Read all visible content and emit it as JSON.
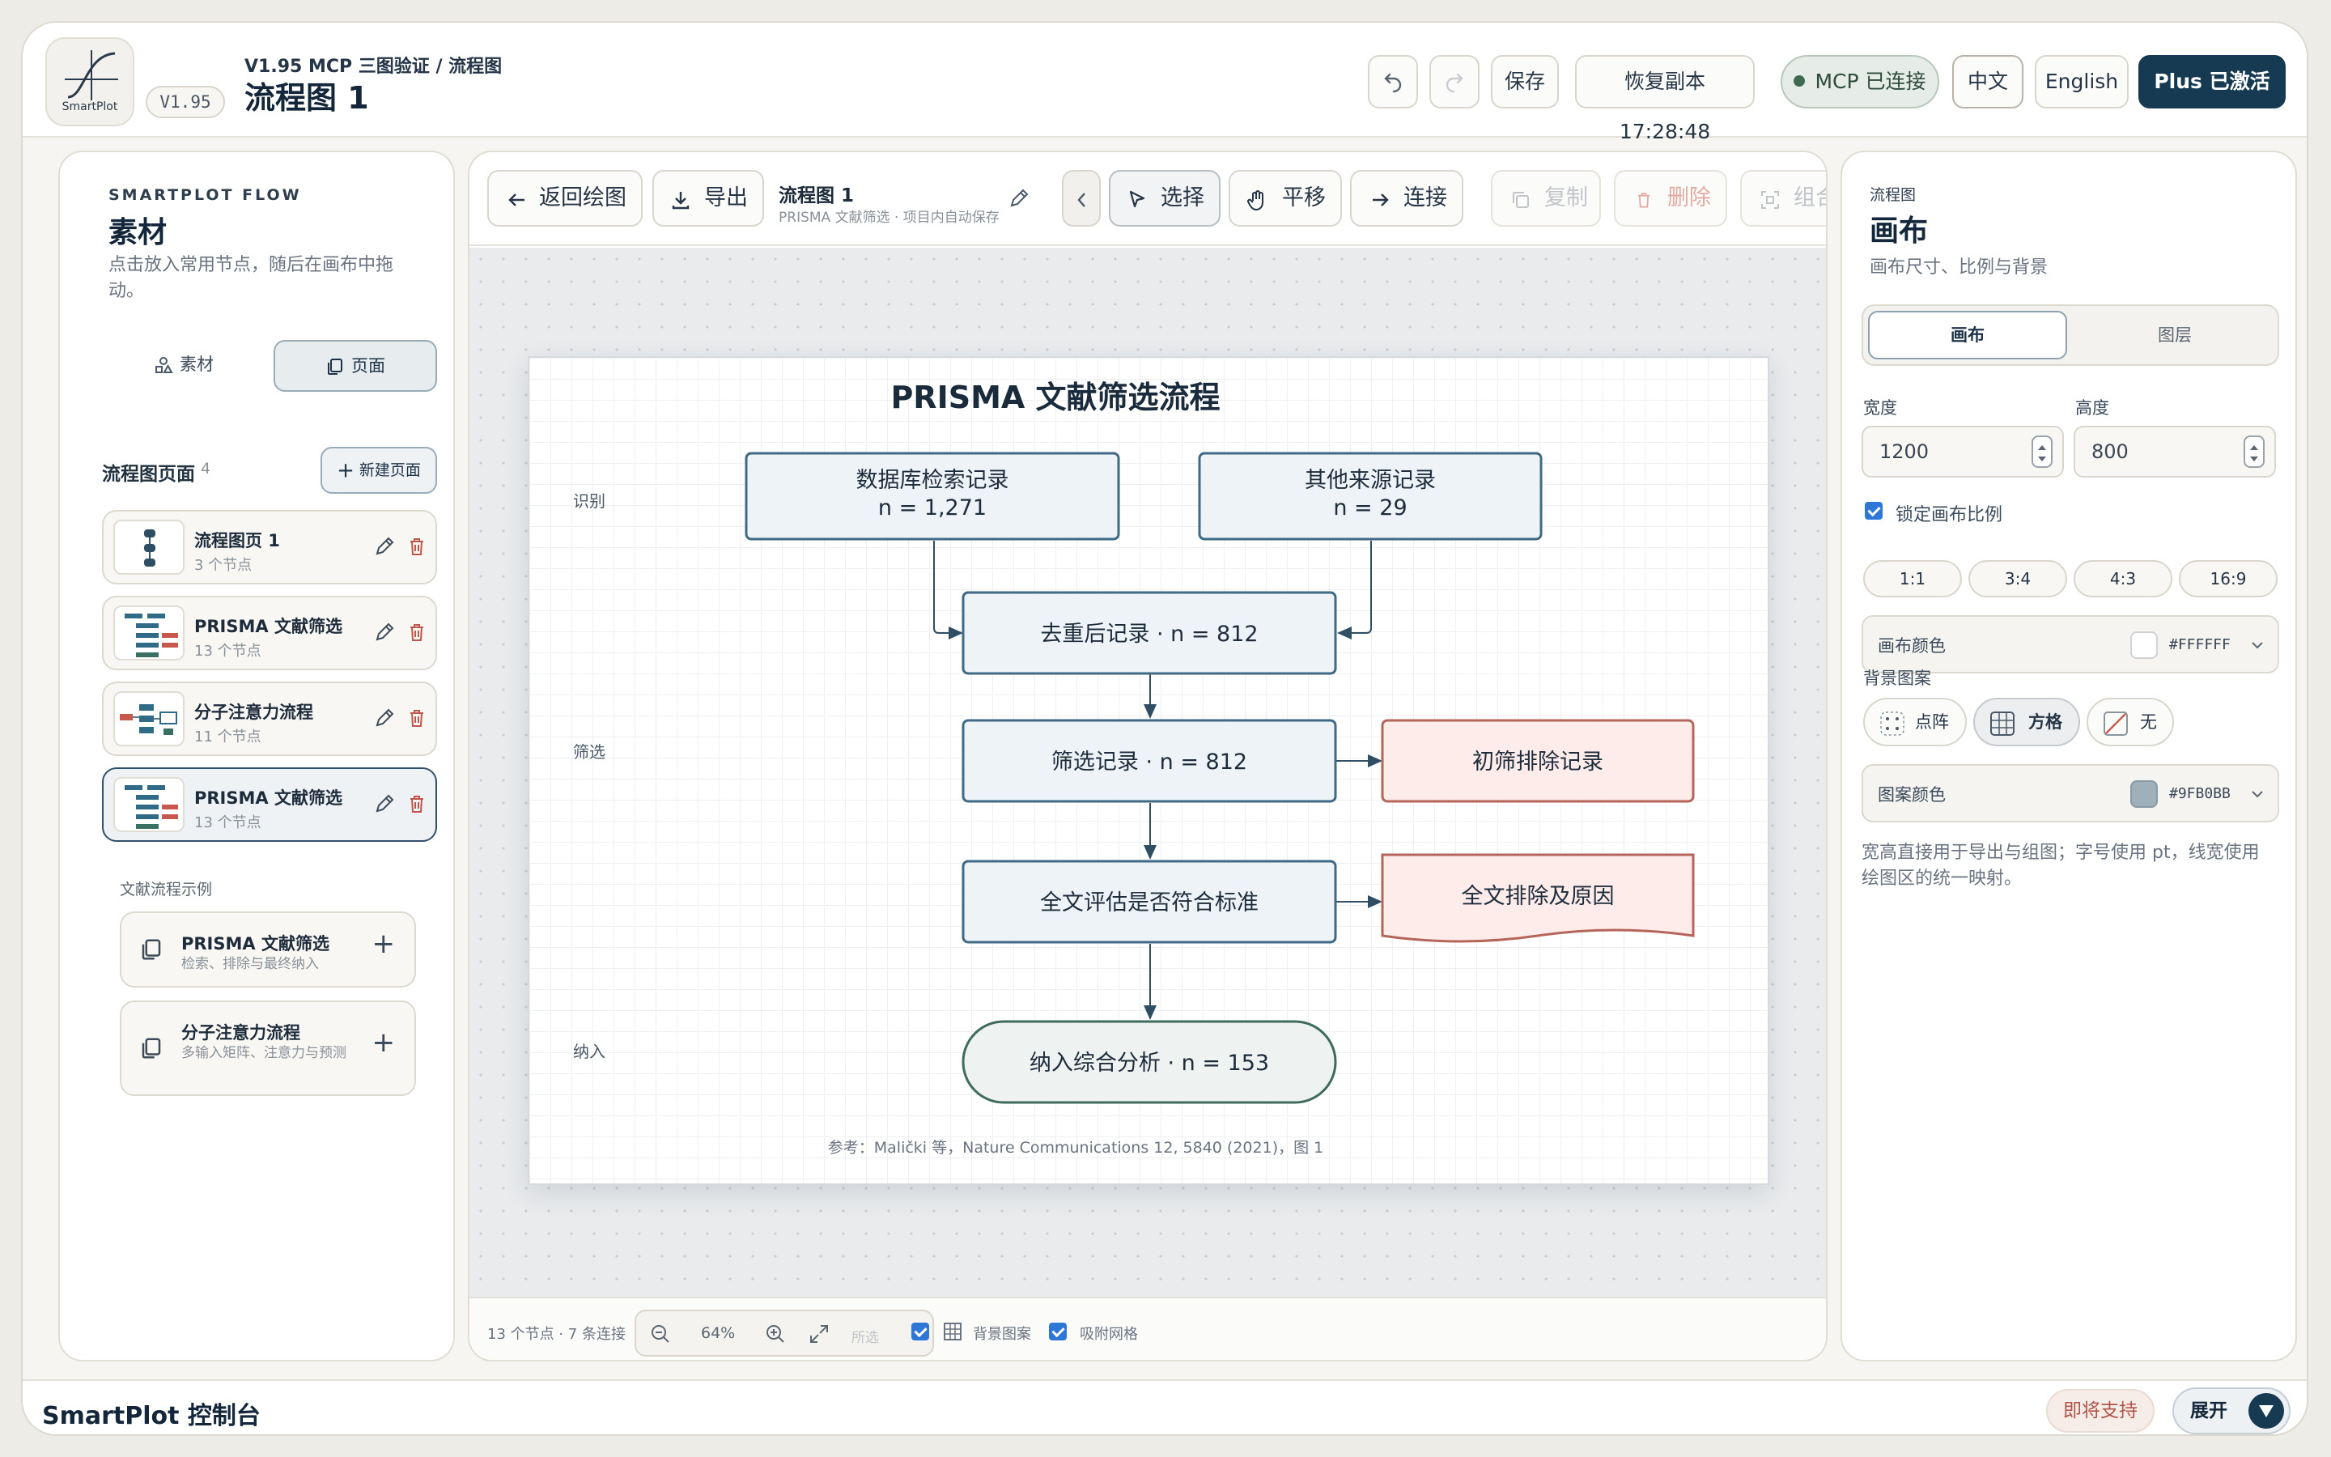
{
  "app": {
    "logo_text": "SmartPlot",
    "version_badge": "V1.95",
    "breadcrumb": "V1.95 MCP 三图验证 / 流程图",
    "title": "流程图 1"
  },
  "header_actions": {
    "save": "保存",
    "restore": "恢复副本 17:28:48",
    "mcp_status": "MCP 已连接",
    "lang_zh": "中文",
    "lang_en": "English",
    "plus": "Plus 已激活"
  },
  "left_panel": {
    "eyebrow": "SMARTPLOT FLOW",
    "title": "素材",
    "description": "点击放入常用节点，随后在画布中拖动。",
    "tabs": [
      {
        "label": "素材",
        "icon": "shapes-icon"
      },
      {
        "label": "页面",
        "icon": "pages-icon",
        "active": true
      }
    ],
    "pages_section": "流程图页面",
    "pages_count": "4",
    "new_page": "新建页面",
    "pages": [
      {
        "name": "流程图页 1",
        "meta": "3 个节点"
      },
      {
        "name": "PRISMA 文献筛选",
        "meta": "13 个节点"
      },
      {
        "name": "分子注意力流程",
        "meta": "11 个节点"
      },
      {
        "name": "PRISMA 文献筛选",
        "meta": "13 个节点",
        "active": true
      }
    ],
    "examples_label": "文献流程示例",
    "examples": [
      {
        "name": "PRISMA 文献筛选",
        "desc": "检索、排除与最终纳入"
      },
      {
        "name": "分子注意力流程",
        "desc": "多输入矩阵、注意力与预测"
      }
    ]
  },
  "toolbar": {
    "back": "返回绘图",
    "export": "导出",
    "doc_title": "流程图 1",
    "doc_sub": "PRISMA 文献筛选 · 项目内自动保存",
    "select": "选择",
    "pan": "平移",
    "connect": "连接",
    "copy": "复制",
    "delete": "删除",
    "group": "组合"
  },
  "diagram": {
    "title": "PRISMA 文献筛选流程",
    "stages": [
      "识别",
      "筛选",
      "纳入"
    ],
    "nodes": {
      "db_title": "数据库检索记录",
      "db_n": "n = 1,271",
      "other_title": "其他来源记录",
      "other_n": "n = 29",
      "dedup": "去重后记录 · n = 812",
      "screen": "筛选记录 · n = 812",
      "excl1": "初筛排除记录",
      "fulltext": "全文评估是否符合标准",
      "excl2": "全文排除及原因",
      "include": "纳入综合分析 · n = 153"
    },
    "reference": "参考：Maličk i 等，Nature Communications 12, 5840 (2021)，图 1"
  },
  "statusbar": {
    "summary": "13 个节点 · 7 条连接",
    "zoom": "64%",
    "fit": "所选",
    "bg_pattern": "背景图案",
    "snap_grid": "吸附网格"
  },
  "right_panel": {
    "eyebrow": "流程图",
    "title": "画布",
    "description": "画布尺寸、比例与背景",
    "seg_canvas": "画布",
    "seg_layers": "图层",
    "width_label": "宽度",
    "height_label": "高度",
    "width_value": "1200",
    "height_value": "800",
    "lock_ratio": "锁定画布比例",
    "ratios": [
      "1:1",
      "3:4",
      "4:3",
      "16:9"
    ],
    "canvas_color_label": "画布颜色",
    "canvas_color": "#FFFFFF",
    "pattern_label": "背景图案",
    "patterns": [
      "点阵",
      "方格",
      "无"
    ],
    "pattern_color_label": "图案颜色",
    "pattern_color": "#9FB0BB",
    "note": "宽高直接用于导出与组图；字号使用 pt，线宽使用绘图区的统一映射。"
  },
  "footer": {
    "title": "SmartPlot 控制台",
    "coming_soon": "即将支持",
    "expand": "展开"
  },
  "colors": {
    "primary_dark": "#163A52",
    "node_fill": "#EEF3F7",
    "node_stroke": "#3E6A86",
    "exclude_fill": "#FDECEA",
    "exclude_stroke": "#B5655A",
    "terminal_stroke": "#3F6B5C"
  }
}
